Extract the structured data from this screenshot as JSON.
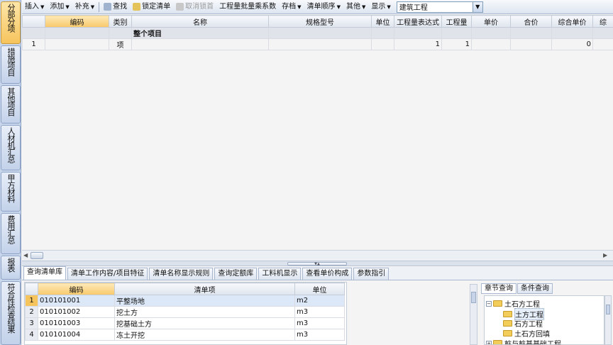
{
  "left_tabs": [
    {
      "label": "分部分项",
      "active": true
    },
    {
      "label": "措施项目",
      "active": false
    },
    {
      "label": "其他项目",
      "active": false
    },
    {
      "label": "人材机汇总",
      "active": false
    },
    {
      "label": "甲方材料",
      "active": false
    },
    {
      "label": "费用汇总",
      "active": false
    },
    {
      "label": "报表",
      "active": false
    },
    {
      "label": "符合性检查结果",
      "active": false
    }
  ],
  "toolbar": {
    "insert": "插入",
    "add": "添加",
    "supplement": "补充",
    "find": "查找",
    "lock": "锁定清单",
    "unlock": "取消锁首",
    "batch": "工程量批量乘系数",
    "save": "存档",
    "order": "清单顺序",
    "other": "其他",
    "display": "显示",
    "combo_value": "建筑工程"
  },
  "grid": {
    "headers": [
      "",
      "编码",
      "类别",
      "名称",
      "规格型号",
      "单位",
      "工程量表达式",
      "工程量",
      "单价",
      "合价",
      "综合单价",
      "综"
    ],
    "project_row": {
      "name": "整个项目"
    },
    "rows": [
      {
        "num": "1",
        "code": "",
        "type": "项",
        "name": "",
        "spec": "",
        "unit": "",
        "expr": "1",
        "qty": "1",
        "price": "",
        "total": "",
        "unit_price": "0",
        "extra": ""
      }
    ]
  },
  "bottom_tabs": [
    {
      "label": "查询清单库",
      "active": true
    },
    {
      "label": "清单工作内容/项目特征",
      "active": false
    },
    {
      "label": "清单名称显示规则",
      "active": false
    },
    {
      "label": "查询定额库",
      "active": false
    },
    {
      "label": "工料机显示",
      "active": false
    },
    {
      "label": "查看单价构成",
      "active": false
    },
    {
      "label": "参数指引",
      "active": false
    }
  ],
  "list": {
    "headers": [
      "",
      "编码",
      "清单项",
      "单位"
    ],
    "rows": [
      {
        "num": "1",
        "code": "010101001",
        "item": "平整场地",
        "unit": "m2"
      },
      {
        "num": "2",
        "code": "010101002",
        "item": "挖土方",
        "unit": "m3"
      },
      {
        "num": "3",
        "code": "010101003",
        "item": "挖基础土方",
        "unit": "m3"
      },
      {
        "num": "4",
        "code": "010101004",
        "item": "冻土开挖",
        "unit": "m3"
      }
    ]
  },
  "tree_tabs": [
    {
      "label": "章节查询",
      "active": true
    },
    {
      "label": "条件查询",
      "active": false
    }
  ],
  "tree": {
    "root": "土石方工程",
    "children": [
      "土方工程",
      "石方工程",
      "土石方回填"
    ],
    "next": "桩与桩基基础工程"
  },
  "colors": {
    "accent": "#f6c45d",
    "tab_bg": "#c9d7ec",
    "header_bg": "#dfe5ee"
  }
}
